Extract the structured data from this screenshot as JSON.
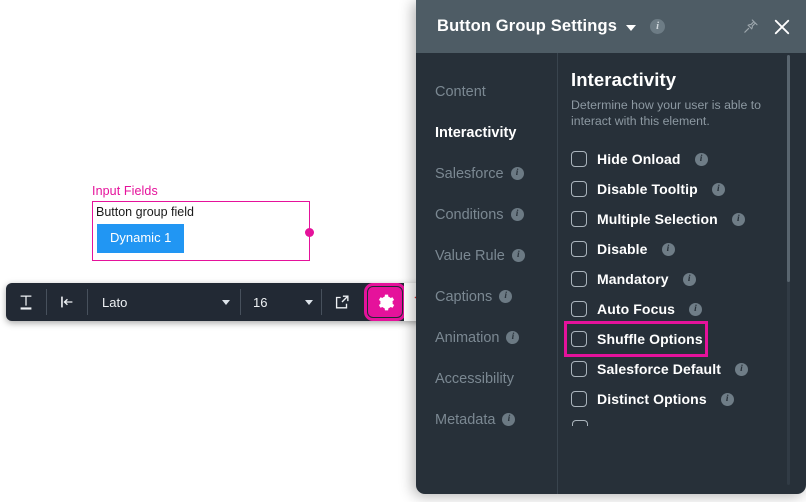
{
  "canvas": {
    "field_legend": "Input Fields",
    "field_label": "Button group field",
    "dynamic_button": "Dynamic 1",
    "accent_color": "#e5129b",
    "button_color": "#2196f3"
  },
  "toolbar": {
    "text_format_icon": "text-format-icon",
    "align_icon": "align-left-icon",
    "font_family": "Lato",
    "font_size": "16",
    "expand_icon": "open-external-icon",
    "settings_icon": "gear-icon",
    "delete_icon": "trash-icon",
    "highlight_color": "#e5129b"
  },
  "panel": {
    "title": "Button Group Settings",
    "title_chevron_icon": "chevron-down-icon",
    "info_icon": "info-icon",
    "pin_icon": "pin-icon",
    "close_icon": "close-icon",
    "nav": [
      {
        "label": "Content",
        "info": false,
        "active": false
      },
      {
        "label": "Interactivity",
        "info": false,
        "active": true
      },
      {
        "label": "Salesforce",
        "info": true,
        "active": false
      },
      {
        "label": "Conditions",
        "info": true,
        "active": false
      },
      {
        "label": "Value Rule",
        "info": true,
        "active": false
      },
      {
        "label": "Captions",
        "info": true,
        "active": false
      },
      {
        "label": "Animation",
        "info": true,
        "active": false
      },
      {
        "label": "Accessibility",
        "info": false,
        "active": false
      },
      {
        "label": "Metadata",
        "info": true,
        "active": false
      }
    ],
    "content": {
      "heading": "Interactivity",
      "description": "Determine how your user is able to interact with this element.",
      "options": [
        {
          "label": "Hide Onload",
          "checked": false,
          "info": true,
          "highlighted": false
        },
        {
          "label": "Disable Tooltip",
          "checked": false,
          "info": true,
          "highlighted": false
        },
        {
          "label": "Multiple Selection",
          "checked": false,
          "info": true,
          "highlighted": false
        },
        {
          "label": "Disable",
          "checked": false,
          "info": true,
          "highlighted": false
        },
        {
          "label": "Mandatory",
          "checked": false,
          "info": true,
          "highlighted": false
        },
        {
          "label": "Auto Focus",
          "checked": false,
          "info": true,
          "highlighted": false
        },
        {
          "label": "Shuffle Options",
          "checked": false,
          "info": false,
          "highlighted": true
        },
        {
          "label": "Salesforce Default",
          "checked": false,
          "info": true,
          "highlighted": false
        },
        {
          "label": "Distinct Options",
          "checked": false,
          "info": true,
          "highlighted": false
        }
      ]
    }
  }
}
